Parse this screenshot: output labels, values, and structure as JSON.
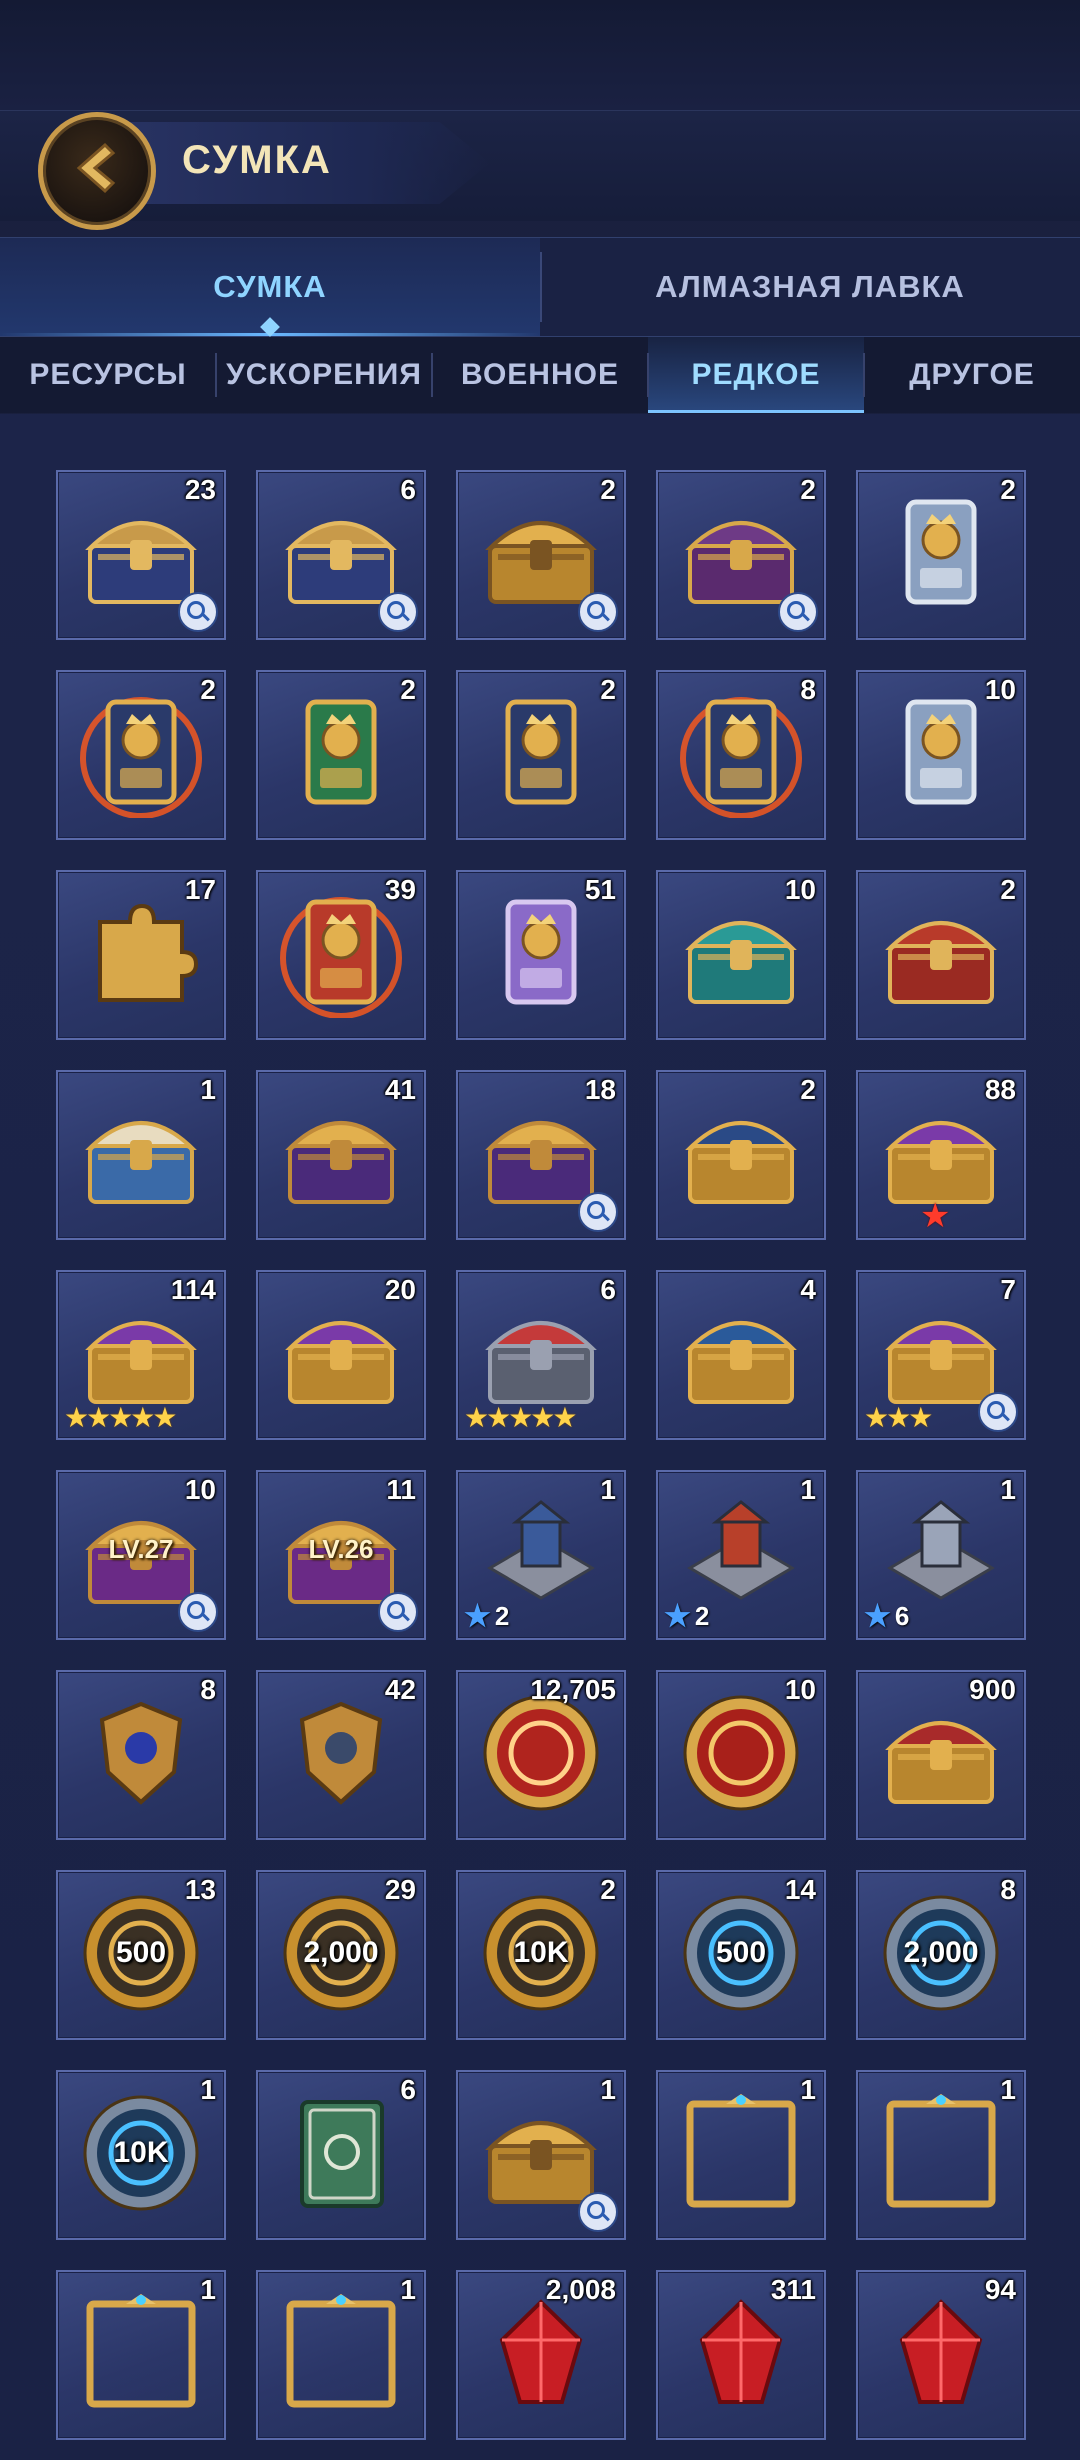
{
  "header": {
    "title": "СУМКА"
  },
  "main_tabs": [
    {
      "label": "СУМКА",
      "active": true
    },
    {
      "label": "АЛМАЗНАЯ ЛАВКА",
      "active": false
    }
  ],
  "sub_tabs": [
    {
      "label": "РЕСУРСЫ",
      "active": false
    },
    {
      "label": "УСКОРЕНИЯ",
      "active": false
    },
    {
      "label": "ВОЕННОЕ",
      "active": false
    },
    {
      "label": "РЕДКОЕ",
      "active": true
    },
    {
      "label": "ДРУГОЕ",
      "active": false
    }
  ],
  "colors": {
    "accent": "#8fd4ff",
    "gold": "#d9a646",
    "cell_border": "#5a6aaa",
    "star": "#ffd34a",
    "hero_star": "#4aa0ff",
    "red_star": "#ff3b2b"
  },
  "items": [
    {
      "icon": "striped-chest-icon",
      "count": "23",
      "mag": true
    },
    {
      "icon": "striped-chest-icon",
      "count": "6",
      "mag": true
    },
    {
      "icon": "gold-chest-icon",
      "count": "2",
      "mag": true
    },
    {
      "icon": "purple-chest-icon",
      "count": "2",
      "mag": true
    },
    {
      "icon": "silver-hero-card-icon",
      "count": "2"
    },
    {
      "icon": "fire-hero-card-icon",
      "count": "2"
    },
    {
      "icon": "green-hero-card-icon",
      "count": "2"
    },
    {
      "icon": "gold-hero-card-icon",
      "count": "2"
    },
    {
      "icon": "fire-hero-card-icon",
      "count": "8"
    },
    {
      "icon": "silver-hero-card-icon",
      "count": "10"
    },
    {
      "icon": "puzzle-piece-icon",
      "count": "17"
    },
    {
      "icon": "red-hero-card-icon",
      "count": "39"
    },
    {
      "icon": "purple-hero-card-icon",
      "count": "51"
    },
    {
      "icon": "teal-chest-icon",
      "count": "10"
    },
    {
      "icon": "red-chest-icon",
      "count": "2"
    },
    {
      "icon": "blue-treasure-chest-icon",
      "count": "1"
    },
    {
      "icon": "purple-gold-chest-icon",
      "count": "41"
    },
    {
      "icon": "purple-gold-chest-icon",
      "count": "18",
      "mag": true
    },
    {
      "icon": "dragon-chest-icon",
      "count": "2"
    },
    {
      "icon": "gem-chest-icon",
      "count": "88",
      "red_star": true
    },
    {
      "icon": "gem-chest-icon",
      "count": "114",
      "stars": "★★★★★"
    },
    {
      "icon": "gem-chest-icon",
      "count": "20"
    },
    {
      "icon": "iron-gem-chest-icon",
      "count": "6",
      "stars": "★★★★★"
    },
    {
      "icon": "blue-puzzle-chest-icon",
      "count": "4"
    },
    {
      "icon": "gem-chest-icon",
      "count": "7",
      "stars": "★★★",
      "mag": true
    },
    {
      "icon": "level-chest-icon",
      "count": "10",
      "label": "LV.27",
      "mag": true
    },
    {
      "icon": "level-chest-icon",
      "count": "11",
      "label": "LV.26",
      "mag": true
    },
    {
      "icon": "blue-building-icon",
      "count": "1",
      "hero_star": "2"
    },
    {
      "icon": "dragon-building-icon",
      "count": "1",
      "hero_star": "2"
    },
    {
      "icon": "stone-building-icon",
      "count": "1",
      "hero_star": "6"
    },
    {
      "icon": "shield-emblem-icon",
      "count": "8"
    },
    {
      "icon": "sword-emblem-icon",
      "count": "42"
    },
    {
      "icon": "red-coin-icon",
      "count": "12,705"
    },
    {
      "icon": "helmet-coin-icon",
      "count": "10"
    },
    {
      "icon": "book-chest-icon",
      "count": "900"
    },
    {
      "icon": "dragon-coin-gold-icon",
      "count": "13",
      "label": "500"
    },
    {
      "icon": "dragon-coin-gold-icon",
      "count": "29",
      "label": "2,000"
    },
    {
      "icon": "dragon-coin-gold-icon",
      "count": "2",
      "label": "10K"
    },
    {
      "icon": "dragon-coin-blue-icon",
      "count": "14",
      "label": "500"
    },
    {
      "icon": "dragon-coin-blue-icon",
      "count": "8",
      "label": "2,000"
    },
    {
      "icon": "dragon-coin-blue-icon",
      "count": "1",
      "label": "10K"
    },
    {
      "icon": "dragon-book-icon",
      "count": "6"
    },
    {
      "icon": "gold-chest-icon",
      "count": "1",
      "mag": true
    },
    {
      "icon": "gold-frame-icon",
      "count": "1"
    },
    {
      "icon": "gold-frame-icon",
      "count": "1"
    },
    {
      "icon": "gold-frame-icon",
      "count": "1"
    },
    {
      "icon": "gold-frame-icon",
      "count": "1"
    },
    {
      "icon": "red-crystal-icon",
      "count": "2,008"
    },
    {
      "icon": "red-crystal-icon",
      "count": "311"
    },
    {
      "icon": "red-crystal-icon",
      "count": "94"
    }
  ]
}
